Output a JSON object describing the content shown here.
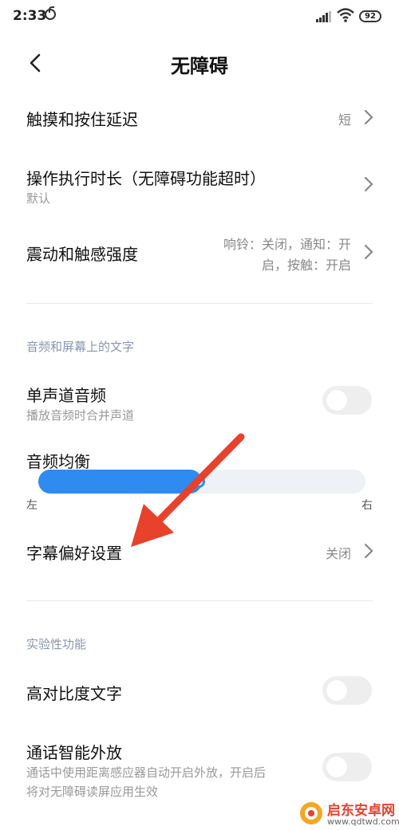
{
  "status_bar": {
    "time": "2:33",
    "battery": "92",
    "icons": [
      "app-icon",
      "signal-icon",
      "wifi-icon",
      "battery-icon"
    ]
  },
  "header": {
    "title": "无障碍",
    "back_icon": "chevron-left-icon"
  },
  "rows": {
    "touch_delay": {
      "title": "触摸和按住延迟",
      "value": "短"
    },
    "action_time": {
      "title": "操作执行时长（无障碍功能超时）",
      "subtitle": "默认"
    },
    "vibration": {
      "title": "震动和触感强度",
      "value_line1": "响铃：关闭，通知：开",
      "value_line2": "启，按触：开启"
    },
    "mono_audio": {
      "title": "单声道音频",
      "subtitle": "播放音频时合并声道",
      "enabled": false
    },
    "audio_balance": {
      "title": "音频均衡",
      "left_label": "左",
      "right_label": "右",
      "balance_fraction": 0.5
    },
    "captions": {
      "title": "字幕偏好设置",
      "value": "关闭"
    },
    "high_contrast": {
      "title": "高对比度文字",
      "enabled": false
    },
    "speaker_call": {
      "title": "通话智能外放",
      "subtitle_line1": "通话中使用距离感应器自动开启外放，开启后",
      "subtitle_line2": "将对无障碍读屏应用生效",
      "enabled": false
    }
  },
  "sections": {
    "audio_screen": "音频和屏幕上的文字",
    "experimental": "实验性功能"
  },
  "annotation": {
    "arrow_color": "#e8412c"
  },
  "watermark": {
    "site": "启东安卓网",
    "url": "www.qdtwd.com"
  },
  "colors": {
    "accent": "#2f8bef",
    "section": "#8a96ad"
  }
}
